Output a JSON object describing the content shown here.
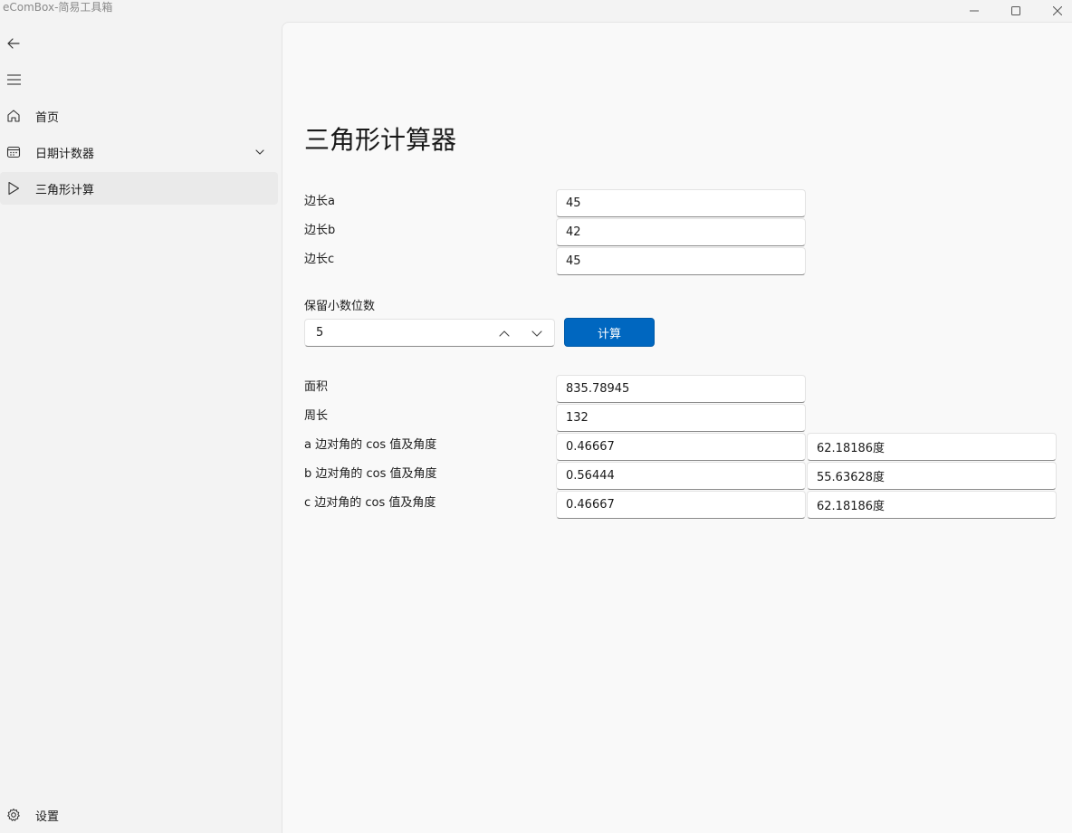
{
  "window": {
    "title": "eComBox-简易工具箱"
  },
  "sidebar": {
    "items": [
      {
        "label": "首页",
        "icon": "home-icon"
      },
      {
        "label": "日期计数器",
        "icon": "calendar-icon"
      },
      {
        "label": "三角形计算",
        "icon": "play-icon"
      }
    ],
    "settings_label": "设置"
  },
  "main": {
    "title": "三角形计算器",
    "inputs": {
      "side_a_label": "边长a",
      "side_a_value": "45",
      "side_b_label": "边长b",
      "side_b_value": "42",
      "side_c_label": "边长c",
      "side_c_value": "45"
    },
    "decimals_label": "保留小数位数",
    "decimals_value": "5",
    "calc_label": "计算",
    "results": {
      "area_label": "面积",
      "area_value": "835.78945",
      "perimeter_label": "周长",
      "perimeter_value": "132",
      "a_label": "a 边对角的 cos 值及角度",
      "a_cos": "0.46667",
      "a_angle": "62.18186度",
      "b_label": "b 边对角的 cos 值及角度",
      "b_cos": "0.56444",
      "b_angle": "55.63628度",
      "c_label": "c 边对角的 cos 值及角度",
      "c_cos": "0.46667",
      "c_angle": "62.18186度"
    }
  },
  "colors": {
    "accent": "#0067c0",
    "background": "#f3f3f3",
    "content_bg": "#f9f9f9"
  }
}
